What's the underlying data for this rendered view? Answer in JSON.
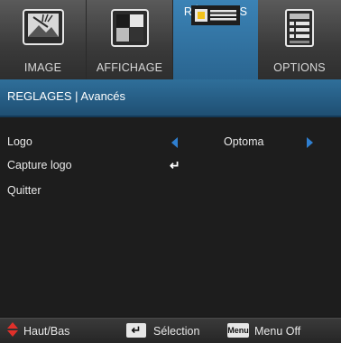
{
  "tabs": [
    {
      "label": "IMAGE",
      "icon": "image-photo-icon",
      "active": false
    },
    {
      "label": "AFFICHAGE",
      "icon": "display-icon",
      "active": false
    },
    {
      "label": "RÉGLAGES",
      "icon": "settings-projector-icon",
      "active": true
    },
    {
      "label": "OPTIONS",
      "icon": "options-list-icon",
      "active": false
    }
  ],
  "header": {
    "title": "REGLAGES | Avancés"
  },
  "menu": {
    "items": [
      {
        "label": "Logo",
        "value": "Optoma",
        "control": "left-right-selector"
      },
      {
        "label": "Capture logo",
        "control": "enter-icon"
      },
      {
        "label": "Quitter"
      }
    ]
  },
  "footer": {
    "navigate": "Haut/Bas",
    "select": "Sélection",
    "menu_key": "Menu",
    "menu_off": "Menu Off"
  },
  "colors": {
    "accent": "#2f7fd0",
    "header_blue": "#2a6590",
    "updown_red": "#e0302a"
  }
}
